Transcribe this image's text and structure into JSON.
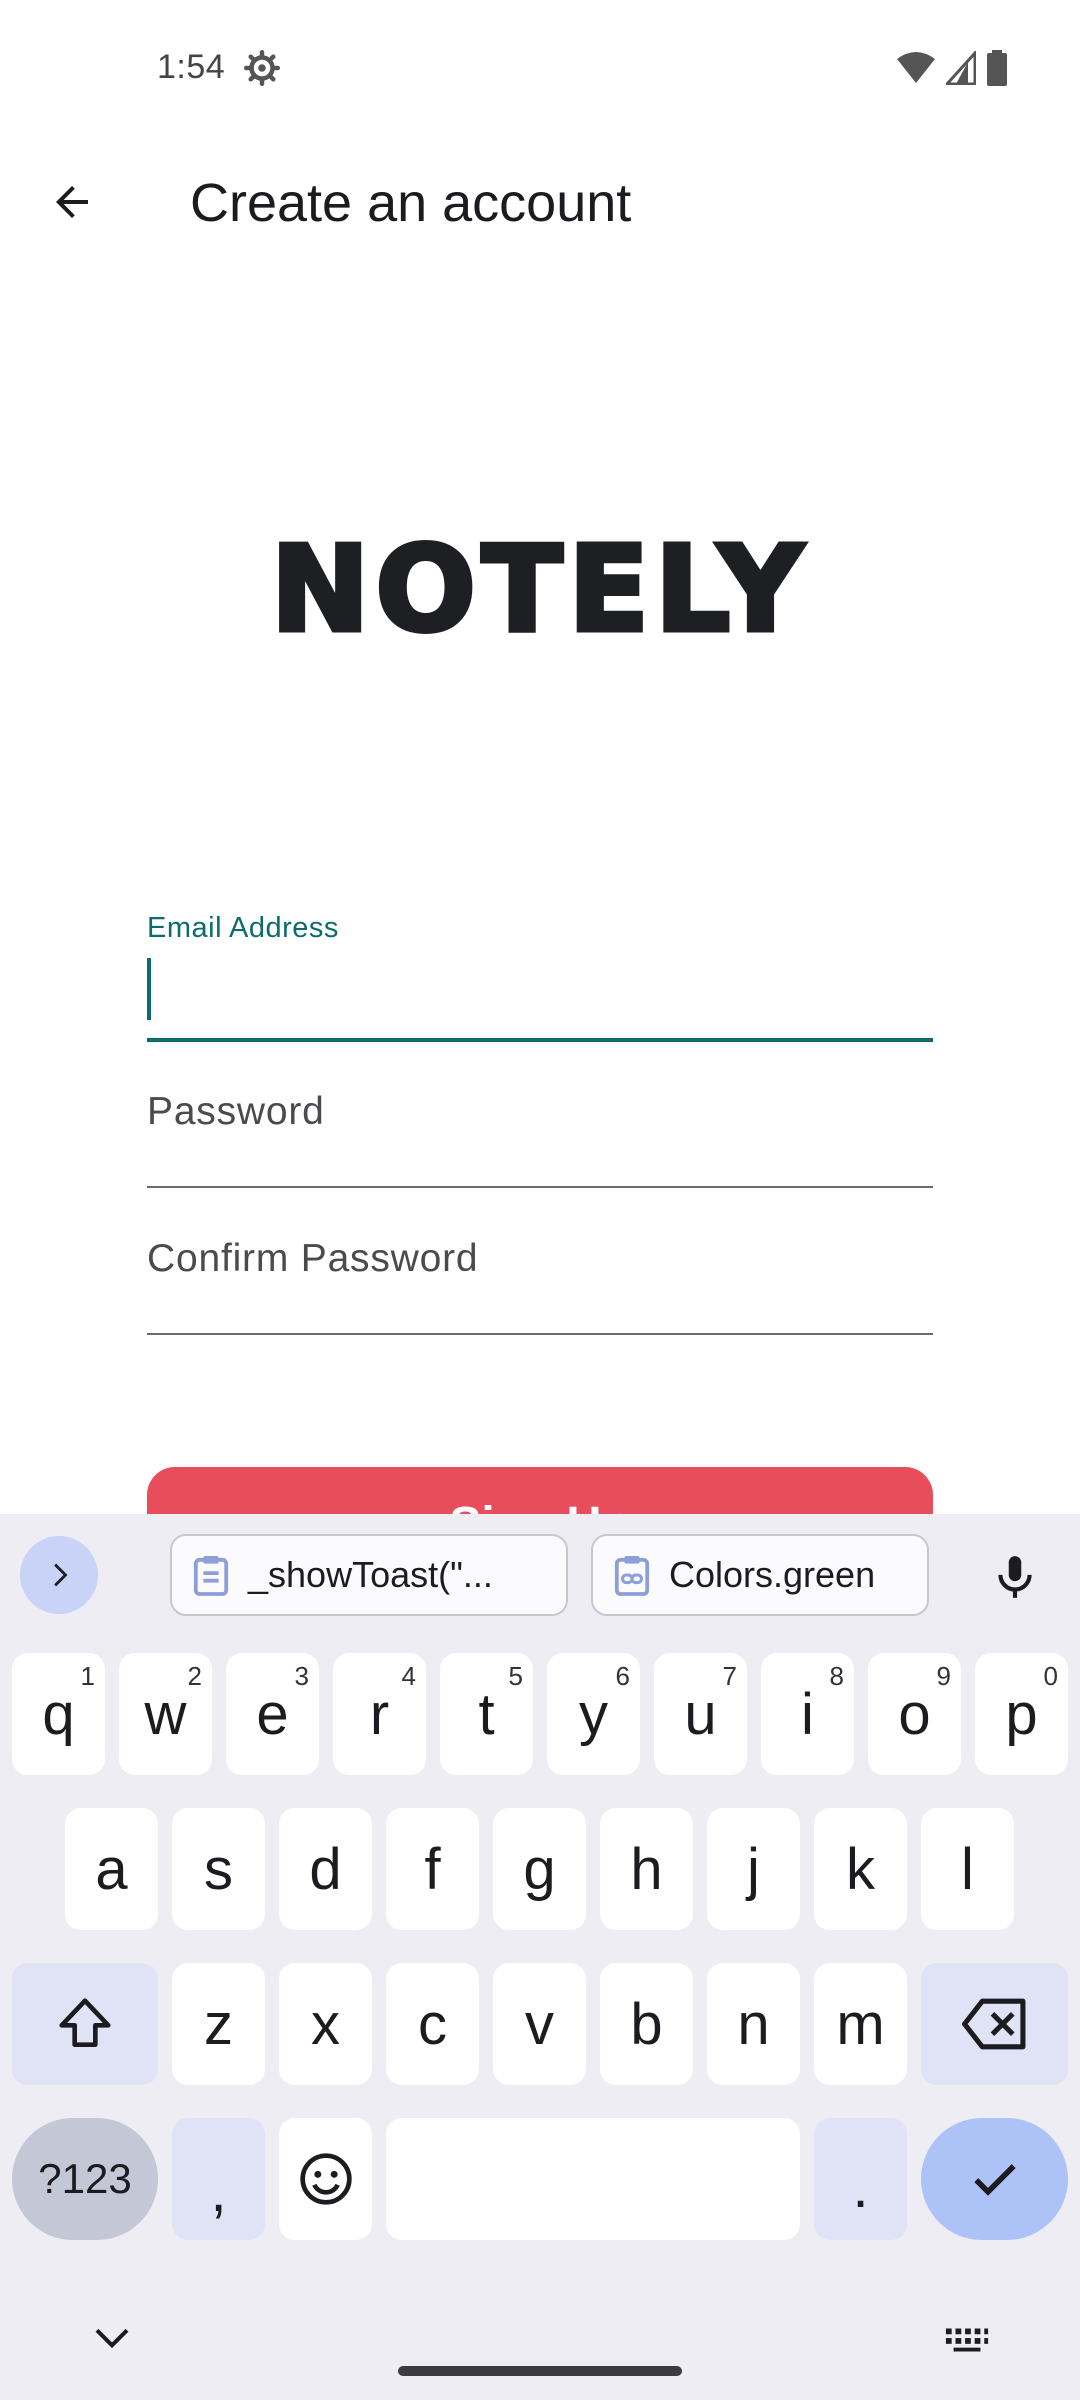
{
  "status_bar": {
    "time": "1:54",
    "icons": [
      "settings-gear-icon",
      "wifi-icon",
      "cell-signal-icon",
      "battery-icon"
    ]
  },
  "app_bar": {
    "back_icon": "arrow-back-icon",
    "title": "Create an account"
  },
  "logo": {
    "text": "NOTELY"
  },
  "form": {
    "email": {
      "label": "Email Address",
      "value": "",
      "focused": true
    },
    "password": {
      "label": "Password",
      "value": ""
    },
    "confirm_password": {
      "label": "Confirm Password",
      "value": ""
    },
    "signup_label": "Sign Up"
  },
  "colors": {
    "accent": "#0d6b6f",
    "button": "#e84d5b",
    "keyboard_bg": "#eeedf4",
    "key_mod": "#dfe3f5",
    "enter_key": "#adc3f7"
  },
  "keyboard": {
    "suggestions": [
      {
        "icon": "clipboard-icon",
        "text": "_showToast(\"..."
      },
      {
        "icon": "clipboard-link-icon",
        "text": "Colors.green"
      }
    ],
    "row1": [
      {
        "key": "q",
        "hint": "1"
      },
      {
        "key": "w",
        "hint": "2"
      },
      {
        "key": "e",
        "hint": "3"
      },
      {
        "key": "r",
        "hint": "4"
      },
      {
        "key": "t",
        "hint": "5"
      },
      {
        "key": "y",
        "hint": "6"
      },
      {
        "key": "u",
        "hint": "7"
      },
      {
        "key": "i",
        "hint": "8"
      },
      {
        "key": "o",
        "hint": "9"
      },
      {
        "key": "p",
        "hint": "0"
      }
    ],
    "row2": [
      "a",
      "s",
      "d",
      "f",
      "g",
      "h",
      "j",
      "k",
      "l"
    ],
    "row3": [
      "z",
      "x",
      "c",
      "v",
      "b",
      "n",
      "m"
    ],
    "symbols_label": "?123",
    "comma_label": ",",
    "period_label": "."
  }
}
